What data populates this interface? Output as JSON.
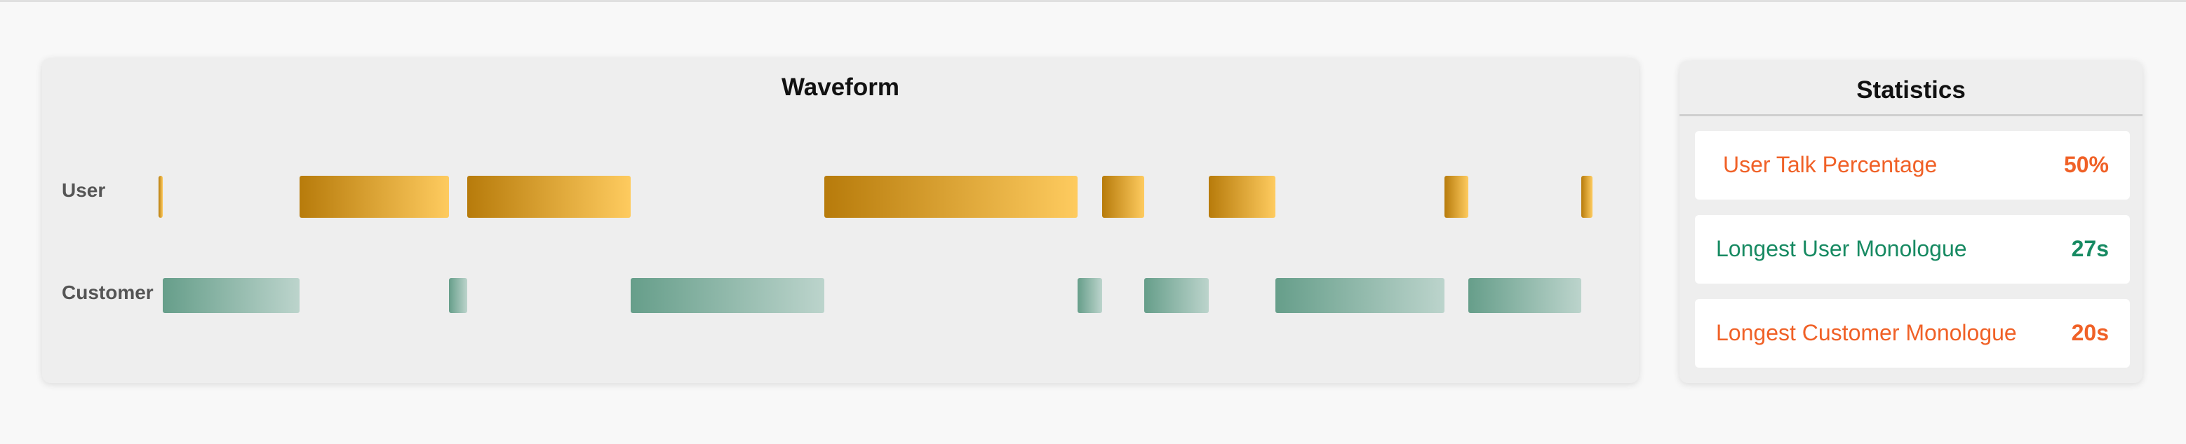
{
  "waveform": {
    "title": "Waveform",
    "tracks": [
      {
        "label": "User",
        "color": "#d99a2a"
      },
      {
        "label": "Customer",
        "color": "#7fae9d"
      }
    ],
    "user_segments": [
      {
        "start": 0.0,
        "end": 0.3
      },
      {
        "start": 10.0,
        "end": 20.6
      },
      {
        "start": 21.9,
        "end": 33.5
      },
      {
        "start": 47.2,
        "end": 65.2
      },
      {
        "start": 66.9,
        "end": 69.9
      },
      {
        "start": 74.5,
        "end": 79.2
      },
      {
        "start": 91.2,
        "end": 92.9
      },
      {
        "start": 100.9,
        "end": 101.7
      }
    ],
    "customer_segments": [
      {
        "start": 0.3,
        "end": 10.0
      },
      {
        "start": 20.6,
        "end": 21.9
      },
      {
        "start": 33.5,
        "end": 47.2
      },
      {
        "start": 65.2,
        "end": 66.9
      },
      {
        "start": 69.9,
        "end": 74.5
      },
      {
        "start": 79.2,
        "end": 91.2
      },
      {
        "start": 92.9,
        "end": 100.9
      }
    ],
    "total": 102
  },
  "statistics": {
    "title": "Statistics",
    "rows": [
      {
        "label": "User Talk Percentage",
        "value": "50%",
        "color": "#f06127"
      },
      {
        "label": "Longest User Monologue",
        "value": "27s",
        "color": "#178a62"
      },
      {
        "label": "Longest Customer Monologue",
        "value": "20s",
        "color": "#f06127"
      }
    ]
  }
}
